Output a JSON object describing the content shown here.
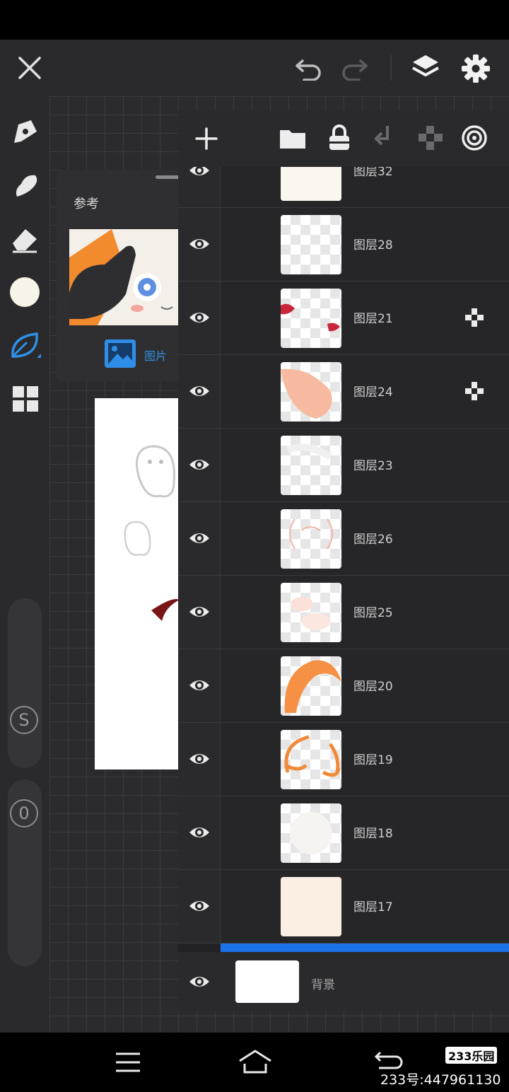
{
  "reference": {
    "title": "参考",
    "image_label": "图片"
  },
  "sliders": {
    "size_label": "S",
    "opacity_label": "0"
  },
  "layers": [
    {
      "name": "图层32",
      "clip": false
    },
    {
      "name": "图层28",
      "clip": false
    },
    {
      "name": "图层21",
      "clip": true
    },
    {
      "name": "图层24",
      "clip": true
    },
    {
      "name": "图层23",
      "clip": false
    },
    {
      "name": "图层26",
      "clip": false
    },
    {
      "name": "图层25",
      "clip": false
    },
    {
      "name": "图层20",
      "clip": false
    },
    {
      "name": "图层19",
      "clip": false
    },
    {
      "name": "图层18",
      "clip": false
    },
    {
      "name": "图层17",
      "clip": false
    }
  ],
  "background_layer": {
    "name": "背景"
  },
  "watermark": {
    "logo": "233乐园",
    "id_text": "233号:447961130"
  },
  "colors": {
    "accent": "#1a73e8",
    "current_brush_color": "#f8f3e8",
    "panel": "#222224",
    "toolbar": "#2a2a2c"
  }
}
